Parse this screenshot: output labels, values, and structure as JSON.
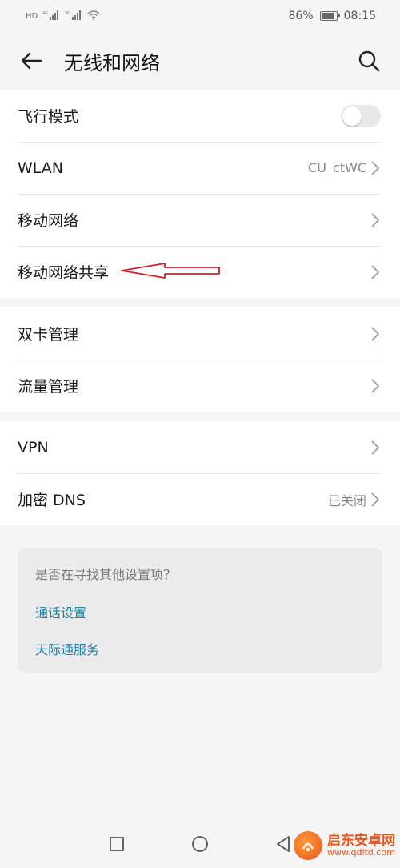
{
  "status_bar": {
    "left_icons": [
      "HD",
      "4G",
      "3G"
    ],
    "battery": "86%",
    "time": "08:15"
  },
  "header": {
    "title": "无线和网络"
  },
  "groups": [
    {
      "items": [
        {
          "label": "飞行模式",
          "control": "toggle",
          "checked": false
        },
        {
          "label": "WLAN",
          "value": "CU_ctWC",
          "control": "chevron"
        },
        {
          "label": "移动网络",
          "control": "chevron"
        },
        {
          "label": "移动网络共享",
          "control": "chevron"
        }
      ]
    },
    {
      "items": [
        {
          "label": "双卡管理",
          "control": "chevron"
        },
        {
          "label": "流量管理",
          "control": "chevron"
        }
      ]
    },
    {
      "items": [
        {
          "label": "VPN",
          "control": "chevron"
        },
        {
          "label": "加密 DNS",
          "value": "已关闭",
          "control": "chevron"
        }
      ]
    }
  ],
  "suggest": {
    "title": "是否在寻找其他设置项？",
    "links": [
      "通话设置",
      "天际通服务"
    ]
  },
  "watermark": {
    "name": "启东安卓网",
    "url": "www.qdltd.com"
  },
  "colors": {
    "link": "#1f7fa3",
    "annotation": "#d0202a"
  }
}
